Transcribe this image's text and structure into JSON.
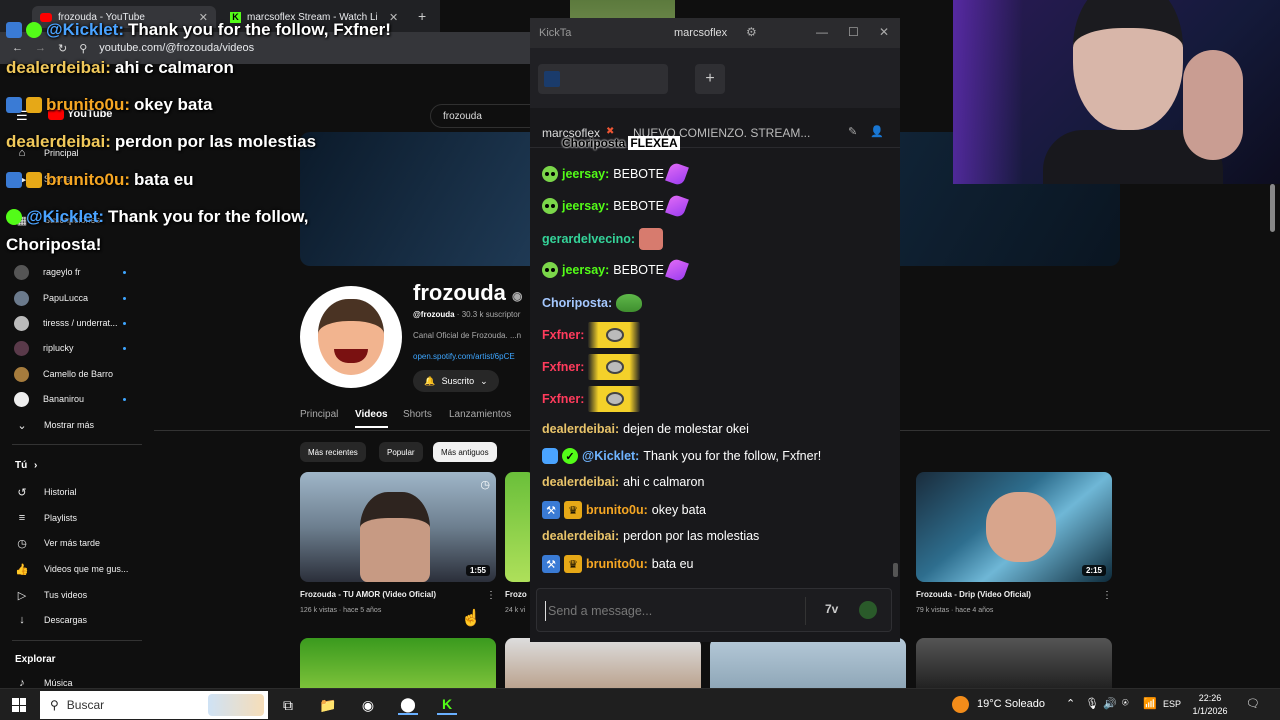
{
  "browser": {
    "tabs": [
      {
        "title": "frozouda - YouTube",
        "active": true
      },
      {
        "title": "marcsoflex Stream - Watch Live",
        "active": false
      }
    ],
    "url": "youtube.com/@frozouda/videos"
  },
  "youtube": {
    "logo": "YouTube",
    "search_value": "frozouda",
    "sidebar": {
      "top_items": [
        {
          "label": "Principal",
          "icon": "home-icon"
        },
        {
          "label": "Shorts",
          "icon": "shorts-icon"
        },
        {
          "label": "Suscripciones",
          "icon": "subscriptions-icon"
        }
      ],
      "subscriptions": [
        {
          "label": "rageylo fr"
        },
        {
          "label": "PapuLucca"
        },
        {
          "label": "tiresss / underrat..."
        },
        {
          "label": "riplucky"
        },
        {
          "label": "Camello de Barro"
        },
        {
          "label": "Bananirou"
        }
      ],
      "show_more": "Mostrar más",
      "you_heading": "Tú",
      "you_items": [
        {
          "label": "Historial",
          "icon": "history-icon"
        },
        {
          "label": "Playlists",
          "icon": "playlists-icon"
        },
        {
          "label": "Ver más tarde",
          "icon": "watch-later-icon"
        },
        {
          "label": "Videos que me gus...",
          "icon": "like-icon"
        },
        {
          "label": "Tus videos",
          "icon": "your-videos-icon"
        },
        {
          "label": "Descargas",
          "icon": "downloads-icon"
        }
      ],
      "explore_heading": "Explorar",
      "explore_items": [
        {
          "label": "Música",
          "icon": "music-icon"
        }
      ]
    },
    "channel": {
      "name": "frozouda",
      "handle": "@frozouda",
      "subs": " · 30.3 k suscriptor",
      "description": "Canal Oficial de Frozouda. ...n",
      "link": "open.spotify.com/artist/6pCE",
      "subscribe_label": "Suscrito"
    },
    "channel_tabs": [
      "Principal",
      "Videos",
      "Shorts",
      "Lanzamientos"
    ],
    "active_channel_tab": "Videos",
    "chips": [
      "Más recientes",
      "Popular",
      "Más antiguos"
    ],
    "active_chip": "Más antiguos",
    "videos": [
      {
        "title": "Frozouda - TU AMOR (Video Oficial)",
        "meta": "126 k vistas · hace 5 años",
        "duration": "1:55"
      },
      {
        "title": "Frozo",
        "meta": "24 k vi",
        "duration": ""
      },
      {
        "title": "Frozouda - Drip (Video Oficial)",
        "meta": "79 k vistas · hace 4 años",
        "duration": "2:15"
      }
    ]
  },
  "overlay_chat": [
    {
      "user": "@Kicklet:",
      "text": "Thank you for the follow, Fxfner!",
      "user_color": "#4aa3ff"
    },
    {
      "user": "dealerdeibai:",
      "text": "ahi c calmaron",
      "user_color": "#f0c85a"
    },
    {
      "user": "brunito0u:",
      "text": "okey bata",
      "user_color": "#f5a623"
    },
    {
      "user": "dealerdeibai:",
      "text": "perdon por las molestias",
      "user_color": "#f0c85a"
    },
    {
      "user": "brunito0u:",
      "text": "bata eu",
      "user_color": "#f5a623"
    },
    {
      "user": "@Kicklet:",
      "text": "Thank you for the follow,",
      "user_color": "#4aa3ff"
    },
    {
      "user": "",
      "text": "Choriposta!",
      "user_color": "#ffffff"
    }
  ],
  "kick": {
    "window_title": "KickTa",
    "window_owner": "marcsoflex",
    "stream_header": {
      "channel": "marcsoflex",
      "title": "NUEVO COMIENZO. STREAM..."
    },
    "pinned": {
      "user": "Choriposta",
      "tag": "FLEXEA"
    },
    "messages": [
      {
        "user": "jeersay:",
        "text": "BEBOTE",
        "user_color": "#53fc18"
      },
      {
        "user": "jeersay:",
        "text": "BEBOTE",
        "user_color": "#53fc18"
      },
      {
        "user": "gerardelvecino:",
        "text": "",
        "user_color": "#34d399"
      },
      {
        "user": "jeersay:",
        "text": "BEBOTE",
        "user_color": "#53fc18"
      },
      {
        "user": "Choriposta:",
        "text": "",
        "user_color": "#a5c8ff"
      },
      {
        "user": "Fxfner:",
        "text": "",
        "user_color": "#ff3b5c"
      },
      {
        "user": "Fxfner:",
        "text": "",
        "user_color": "#ff3b5c"
      },
      {
        "user": "Fxfner:",
        "text": "",
        "user_color": "#ff3b5c"
      },
      {
        "user": "dealerdeibai:",
        "text": "dejen de molestar okei",
        "user_color": "#e9c46a"
      },
      {
        "user": "@Kicklet:",
        "text": "Thank you for the follow, Fxfner!",
        "user_color": "#6fb4ff"
      },
      {
        "user": "dealerdeibai:",
        "text": "ahi c calmaron",
        "user_color": "#e9c46a"
      },
      {
        "user": "brunito0u:",
        "text": "okey bata",
        "user_color": "#f5a623"
      },
      {
        "user": "dealerdeibai:",
        "text": "perdon por las molestias",
        "user_color": "#e9c46a"
      },
      {
        "user": "brunito0u:",
        "text": "bata eu",
        "user_color": "#f5a623"
      }
    ],
    "input_placeholder": "Send a message..."
  },
  "taskbar": {
    "search_placeholder": "Buscar",
    "weather": "19°C  Soleado",
    "lang": "ESP",
    "time": "22:26",
    "date": "1/1/2026"
  }
}
